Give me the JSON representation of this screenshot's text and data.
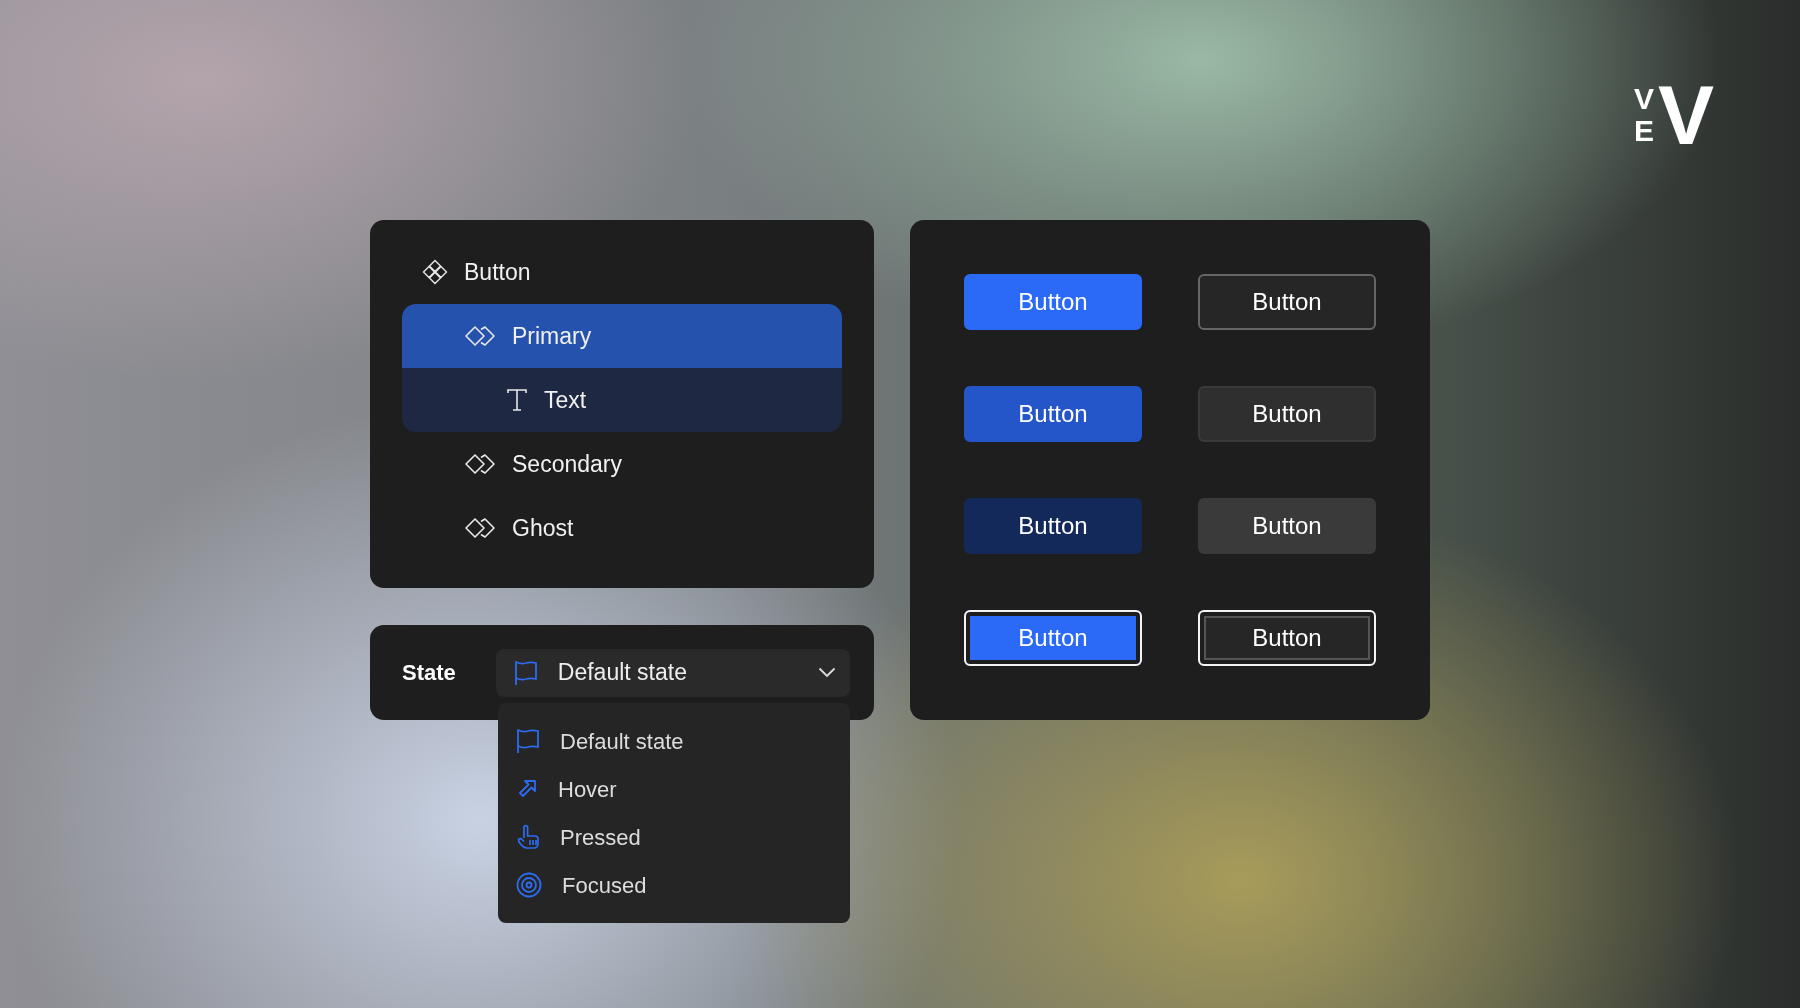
{
  "logo": {
    "small_top": "V",
    "small_bottom": "E",
    "large": "V"
  },
  "tree": {
    "label": "Button",
    "kind": "component",
    "children": [
      {
        "label": "Primary",
        "kind": "variant",
        "selected": true,
        "expanded": true,
        "children": [
          {
            "label": "Text",
            "kind": "text"
          }
        ]
      },
      {
        "label": "Secondary",
        "kind": "variant",
        "selected": false
      },
      {
        "label": "Ghost",
        "kind": "variant",
        "selected": false
      }
    ]
  },
  "state_field": {
    "label": "State",
    "value": "Default state",
    "kind": "flag",
    "expanded": true,
    "options": [
      {
        "label": "Default state",
        "kind": "flag"
      },
      {
        "label": "Hover",
        "kind": "arrow"
      },
      {
        "label": "Pressed",
        "kind": "hand"
      },
      {
        "label": "Focused",
        "kind": "target"
      }
    ]
  },
  "preview": {
    "buttons": [
      {
        "label": "Button",
        "kind": "primary",
        "hovered": false,
        "pressed": false,
        "focused": false
      },
      {
        "label": "Button",
        "kind": "secondary",
        "hovered": false,
        "pressed": false,
        "focused": false
      },
      {
        "label": "Button",
        "kind": "primary",
        "hovered": true,
        "pressed": false,
        "focused": false
      },
      {
        "label": "Button",
        "kind": "secondary",
        "hovered": true,
        "pressed": false,
        "focused": false
      },
      {
        "label": "Button",
        "kind": "primary",
        "hovered": false,
        "pressed": true,
        "focused": false
      },
      {
        "label": "Button",
        "kind": "secondary",
        "hovered": false,
        "pressed": true,
        "focused": false
      },
      {
        "label": "Button",
        "kind": "primary",
        "hovered": false,
        "pressed": false,
        "focused": true
      },
      {
        "label": "Button",
        "kind": "secondary",
        "hovered": false,
        "pressed": false,
        "focused": true
      }
    ]
  }
}
